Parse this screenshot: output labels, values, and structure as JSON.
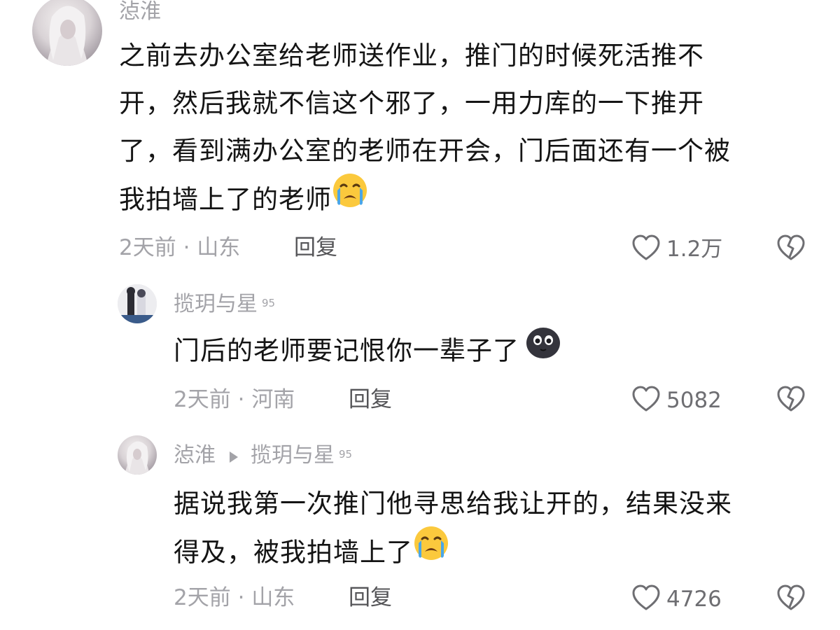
{
  "comments": [
    {
      "username": "惉淮",
      "text_lines": [
        "之前去办公室给老师送作业，推门的时候死活推不",
        "开，然后我就不信这个邪了，一用力库的一下推开",
        "了，看到满办公室的老师在开会，门后面还有一个被",
        "我拍墙上了的老师"
      ],
      "emoji": "loudly-crying-face",
      "time": "2天前",
      "separator": "·",
      "location": "山东",
      "reply_label": "回复",
      "likes": "1.2万"
    },
    {
      "username": "揽玥与星",
      "badge": "95",
      "text_lines": [
        "门后的老师要记恨你一辈子了"
      ],
      "emoji": "dark-blob-face",
      "time": "2天前",
      "separator": "·",
      "location": "河南",
      "reply_label": "回复",
      "likes": "5082"
    },
    {
      "username": "惉淮",
      "reply_to": "揽玥与星",
      "badge": "95",
      "text_lines": [
        "据说我第一次推门他寻思给我让开的，结果没来",
        "得及，被我拍墙上了"
      ],
      "emoji": "loudly-crying-face",
      "time": "2天前",
      "separator": "·",
      "location": "山东",
      "reply_label": "回复",
      "likes": "4726"
    }
  ],
  "icons": {
    "like": "heart-outline-icon",
    "dislike": "broken-heart-outline-icon"
  },
  "colors": {
    "meta_gray": "#a3a3a8",
    "text": "#141414",
    "emoji_yellow": "#fbc93d",
    "emoji_blue": "#4aa6e8"
  }
}
